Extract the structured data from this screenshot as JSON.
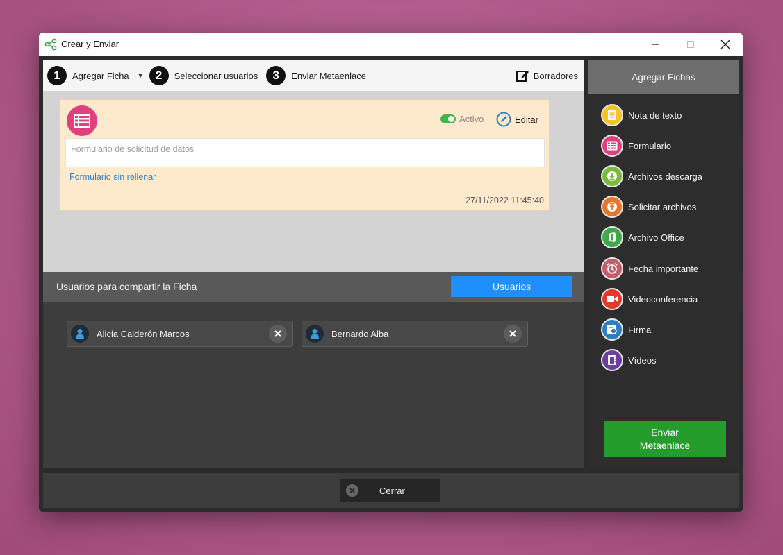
{
  "window": {
    "title": "Crear y Enviar"
  },
  "steps": [
    {
      "num": "1",
      "label": "Agregar Ficha"
    },
    {
      "num": "2",
      "label": "Seleccionar usuarios"
    },
    {
      "num": "3",
      "label": "Enviar Metaenlace"
    }
  ],
  "toolbar": {
    "drafts_label": "Borradores"
  },
  "card": {
    "status": "Activo",
    "edit_label": "Editar",
    "placeholder": "Formulario de solicitud de datos",
    "link": "Formulario sin rellenar",
    "timestamp": "27/11/2022 11:45:40",
    "icon": "form-list-icon",
    "color": "#e0407d"
  },
  "users_section": {
    "label": "Usuarios para compartir la Ficha",
    "button": "Usuarios",
    "users": [
      {
        "name": "Alicia Calderón Marcos"
      },
      {
        "name": "Bernardo Alba"
      }
    ]
  },
  "sidebar": {
    "header": "Agregar Fichas",
    "items": [
      {
        "label": "Nota de texto",
        "icon": "text-note-icon",
        "color": "#f5c421"
      },
      {
        "label": "Formulario",
        "icon": "form-list-icon",
        "color": "#e0407d"
      },
      {
        "label": "Archivos descarga",
        "icon": "download-icon",
        "color": "#7cbc3c"
      },
      {
        "label": "Solicitar archivos",
        "icon": "upload-icon",
        "color": "#e8752a"
      },
      {
        "label": "Archivo Office",
        "icon": "office-icon",
        "color": "#3ea84a"
      },
      {
        "label": "Fecha importante",
        "icon": "alarm-clock-icon",
        "color": "#c65d6b"
      },
      {
        "label": "Videoconferencia",
        "icon": "video-camera-icon",
        "color": "#e53a2b"
      },
      {
        "label": "Firma",
        "icon": "signature-icon",
        "color": "#2d7fc1"
      },
      {
        "label": "Vídeos",
        "icon": "film-icon",
        "color": "#6a3fa0"
      }
    ],
    "send_button": "Enviar\nMetaenlace"
  },
  "footer": {
    "close_label": "Cerrar"
  },
  "colors": {
    "accent": "#1e8ffc",
    "send": "#249c2b"
  }
}
